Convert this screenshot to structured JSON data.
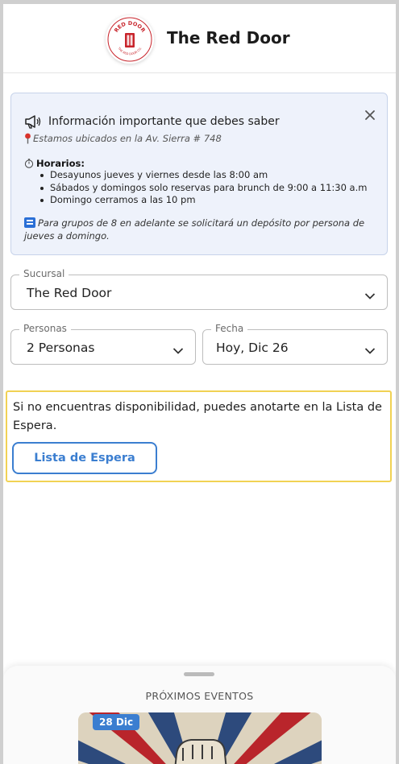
{
  "header": {
    "title": "The Red Door",
    "logo": {
      "top_text": "RED DOOR",
      "bottom_text": "THE RED DOOR CO."
    }
  },
  "info": {
    "title": "Información importante que debes saber",
    "location": "Estamos ubicados en la Av. Sierra # 748",
    "hours_heading": "Horarios:",
    "hours": [
      "Desayunos jueves y viernes desde las 8:00 am",
      "Sábados y domingos solo reservas para brunch de 9:00 a 11:30 a.m",
      "Domingo cerramos a las 10 pm"
    ],
    "group_note": "Para grupos de 8 en adelante se solicitará un depósito por persona de jueves a domingo.",
    "icons": {
      "title": "megaphone-icon",
      "close": "close-icon",
      "location": "pin-icon",
      "hours": "timer-icon",
      "group": "info-badge-icon"
    }
  },
  "form": {
    "branch": {
      "label": "Sucursal",
      "value": "The Red Door"
    },
    "people": {
      "label": "Personas",
      "value": "2 Personas"
    },
    "date": {
      "label": "Fecha",
      "value": "Hoy, Dic 26"
    }
  },
  "waitlist": {
    "message": "Si no encuentras disponibilidad, puedes anotarte en la Lista de Espera.",
    "button": "Lista de Espera"
  },
  "events": {
    "title": "PRÓXIMOS EVENTOS",
    "items": [
      {
        "date_badge": "28 Dic"
      }
    ]
  },
  "colors": {
    "accent": "#3b7ed0",
    "brand_red": "#c8242b",
    "info_bg": "#eef2fb",
    "waitlist_border": "#f1d254"
  }
}
